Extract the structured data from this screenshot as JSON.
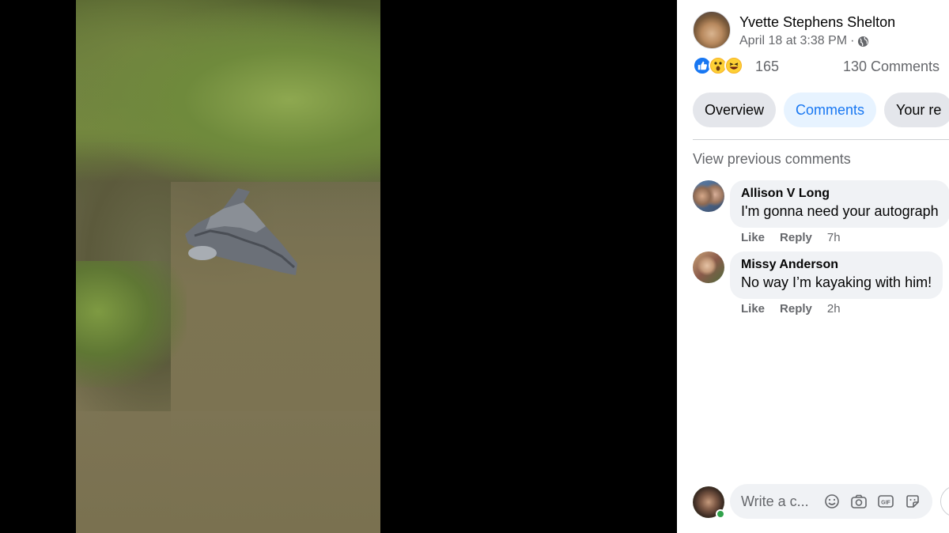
{
  "post": {
    "author": "Yvette Stephens Shelton",
    "timestamp": "April 18 at 3:38 PM",
    "separator": "·",
    "audience_icon": "globe-icon"
  },
  "reactions": {
    "icons": [
      "like-icon",
      "wow-icon",
      "haha-icon"
    ],
    "count": "165",
    "comments": "130 Comments",
    "colors": {
      "like": "#1877f2",
      "wow": "#f7b125",
      "haha": "#f7b125"
    }
  },
  "tabs": [
    {
      "label": "Overview",
      "active": false
    },
    {
      "label": "Comments",
      "active": true
    },
    {
      "label": "Your re",
      "active": false
    }
  ],
  "view_previous": "View previous comments",
  "comments": [
    {
      "name": "Allison V Long",
      "text": "I'm gonna need your autograph",
      "like": "Like",
      "reply": "Reply",
      "time": "7h"
    },
    {
      "name": "Missy Anderson",
      "text": "No way I’m kayaking with him!",
      "like": "Like",
      "reply": "Reply",
      "time": "2h"
    }
  ],
  "composer": {
    "placeholder": "Write a c...",
    "tools": [
      "emoji-icon",
      "camera-icon",
      "gif-icon",
      "sticker-icon"
    ]
  },
  "colors": {
    "accent": "#1877f2",
    "online": "#31a24c",
    "bubble": "#f0f2f5",
    "secondary_text": "#65676b"
  }
}
